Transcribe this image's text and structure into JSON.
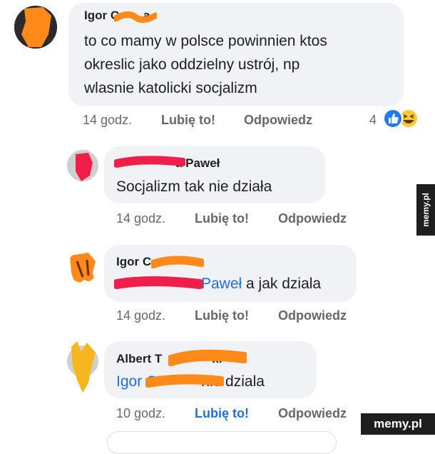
{
  "comments": [
    {
      "author": "Igor C",
      "author_tail": "a",
      "lines": [
        "to co mamy w polsce powinnien ktos",
        "okreslic jako oddzielny ustrój, np",
        "wlasnie katolicki socjalizm"
      ],
      "time": "14 godz.",
      "like": "Lubię to!",
      "reply": "Odpowiedz",
      "reaction_count": "4",
      "reactions": [
        "like-icon",
        "haha-icon"
      ]
    },
    {
      "author": "a Paweł",
      "text": "Socjalizm tak nie działa",
      "time": "14 godz.",
      "like": "Lubię to!",
      "reply": "Odpowiedz"
    },
    {
      "author": "Igor C",
      "author_tail": "a",
      "mention": "Paweł",
      "text": " a jak dziala",
      "time": "14 godz.",
      "like": "Lubię to!",
      "reply": "Odpowiedz"
    },
    {
      "author": "Albert T",
      "author_tail": "ki",
      "mention": "Igor C",
      "text": "nie dziala",
      "time": "10 godz.",
      "like": "Lubię to!",
      "reply": "Odpowiedz",
      "like_active": true
    }
  ],
  "watermark": "memy.pl",
  "colors": {
    "bubble": "#f0f2f5",
    "link": "#216fdb",
    "meta": "#65676b",
    "orange_scribble": "#ff8a1a",
    "red_scribble": "#f01e4a"
  }
}
